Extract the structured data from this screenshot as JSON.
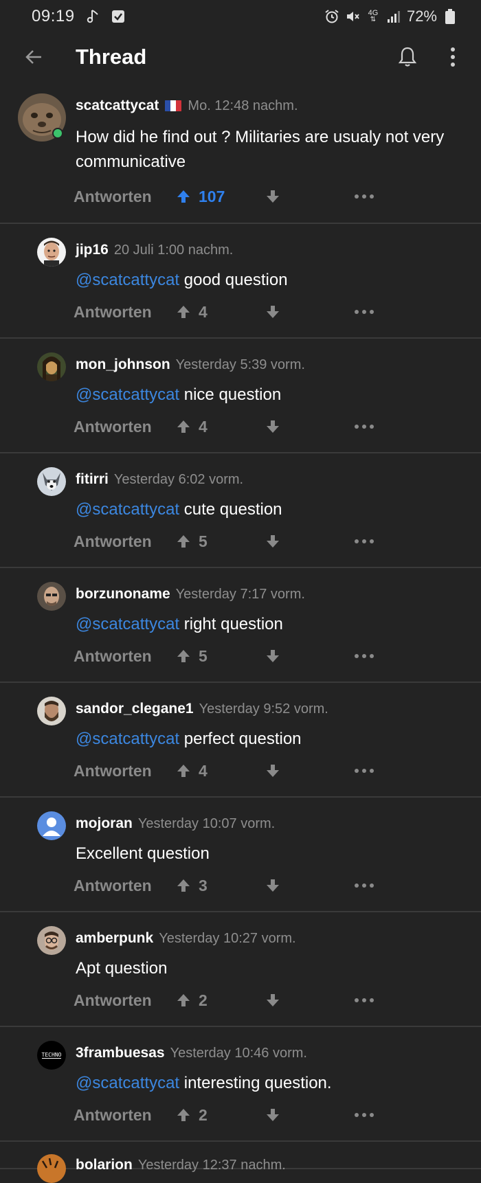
{
  "status": {
    "time": "09:19",
    "battery": "72%",
    "network": "4G"
  },
  "appbar": {
    "title": "Thread"
  },
  "colors": {
    "background": "#232323",
    "accent": "#2f80ed",
    "mention": "#3c87e0",
    "muted": "#8a8a8a",
    "online": "#3cc36b"
  },
  "main": {
    "username": "scatcattycat",
    "timestamp": "Mo. 12:48 nachm.",
    "text": "How did he find out ? Militaries are usualy not very communicative",
    "reply_label": "Antworten",
    "upvotes": "107",
    "upvoted": true
  },
  "replies": [
    {
      "username": "jip16",
      "timestamp": "20 Juli 1:00 nachm.",
      "mention": "@scatcattycat",
      "text": " good question",
      "reply_label": "Antworten",
      "upvotes": "4",
      "avatar": "bean-face"
    },
    {
      "username": "mon_johnson",
      "timestamp": "Yesterday 5:39 vorm.",
      "mention": "@scatcattycat",
      "text": " nice question",
      "reply_label": "Antworten",
      "upvotes": "4",
      "avatar": "mona-lisa"
    },
    {
      "username": "fitirri",
      "timestamp": "Yesterday 6:02 vorm.",
      "mention": "@scatcattycat",
      "text": " cute question",
      "reply_label": "Antworten",
      "upvotes": "5",
      "avatar": "husky"
    },
    {
      "username": "borzunoname",
      "timestamp": "Yesterday 7:17 vorm.",
      "mention": "@scatcattycat",
      "text": " right question",
      "reply_label": "Antworten",
      "upvotes": "5",
      "avatar": "bald-man"
    },
    {
      "username": "sandor_clegane1",
      "timestamp": "Yesterday 9:52 vorm.",
      "mention": "@scatcattycat",
      "text": " perfect question",
      "reply_label": "Antworten",
      "upvotes": "4",
      "avatar": "bearded-man"
    },
    {
      "username": "mojoran",
      "timestamp": "Yesterday 10:07 vorm.",
      "mention": "",
      "text": "Excellent question",
      "reply_label": "Antworten",
      "upvotes": "3",
      "avatar": "default-person"
    },
    {
      "username": "amberpunk",
      "timestamp": "Yesterday 10:27 vorm.",
      "mention": "",
      "text": "Apt question",
      "reply_label": "Antworten",
      "upvotes": "2",
      "avatar": "glasses-man"
    },
    {
      "username": "3frambuesas",
      "timestamp": "Yesterday 10:46 vorm.",
      "mention": "@scatcattycat",
      "text": " interesting question.",
      "reply_label": "Antworten",
      "upvotes": "2",
      "avatar": "techno-logo",
      "avatar_text": "TECHNO"
    }
  ],
  "partial": {
    "username": "bolarion",
    "timestamp": "Yesterday 12:37 nachm."
  }
}
